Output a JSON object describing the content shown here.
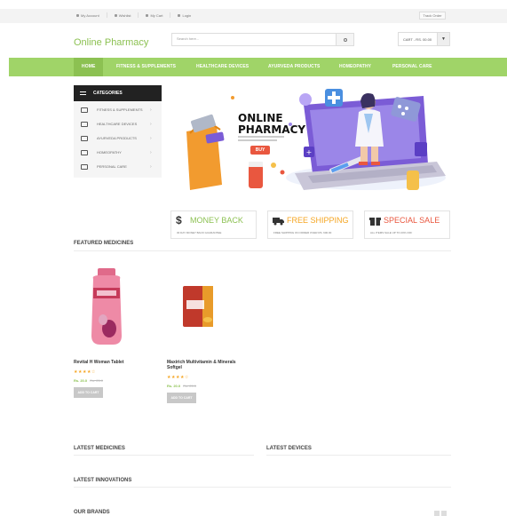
{
  "topbar": {
    "links": [
      "My Account",
      "Wishlist",
      "My Cart",
      "Login"
    ],
    "track_order": "Track Order"
  },
  "header": {
    "logo": "Online Pharmacy",
    "search_placeholder": "Search here...",
    "cart_text": "CART - RS. 00.00",
    "cart_count": "0"
  },
  "nav": {
    "items": [
      "HOME",
      "FITNESS & SUPPLEMENTS",
      "HEALTHCARE DEVICES",
      "AYURVEDA PRODUCTS",
      "HOMEOPATHY",
      "PERSONAL CARE"
    ]
  },
  "categories": {
    "title": "CATEGORIES",
    "items": [
      "FITNESS & SUPPLEMENTS",
      "HEALTHCARE DEVICES",
      "AYURVEDA PRODUCTS",
      "HOMEOPATHY",
      "PERSONAL CARE"
    ]
  },
  "banner": {
    "headline_1": "ONLINE",
    "headline_2": "PHARMACY",
    "button": "BUY"
  },
  "features": [
    {
      "title": "MONEY BACK",
      "subtitle": "30 DAY MONEY BACK GUARANTEE",
      "color": "#8cc152"
    },
    {
      "title": "FREE SHIPPING",
      "subtitle": "FREE SHIPPING ON ORDER OVER RS. 600.00",
      "color": "#f5a623"
    },
    {
      "title": "SPECIAL SALE",
      "subtitle": "ALL ITEMS SALE UP TO 20% OFF",
      "color": "#e9573f"
    }
  ],
  "featured": {
    "title": "FEATURED MEDICINES",
    "products": [
      {
        "name": "Revital H Woman Tablet",
        "stars": "★★★★☆",
        "price": "Rs. 20.0",
        "old_price": "Rs. 25.0",
        "button": "ADD TO CART"
      },
      {
        "name": "Maxirich Multivitamin & Minerals Softgel",
        "stars": "★★★★☆",
        "price": "Rs. 20.0",
        "old_price": "Rs. 25.0",
        "button": "ADD TO CART"
      }
    ]
  },
  "sections": {
    "latest_medicines": "LATEST MEDICINES",
    "latest_devices": "LATEST DEVICES",
    "latest_innovations": "LATEST INNOVATIONS",
    "our_brands": "OUR BRANDS"
  },
  "colors": {
    "brand_green": "#8cc152",
    "nav_green": "#a0d468",
    "star": "#f5a623"
  }
}
